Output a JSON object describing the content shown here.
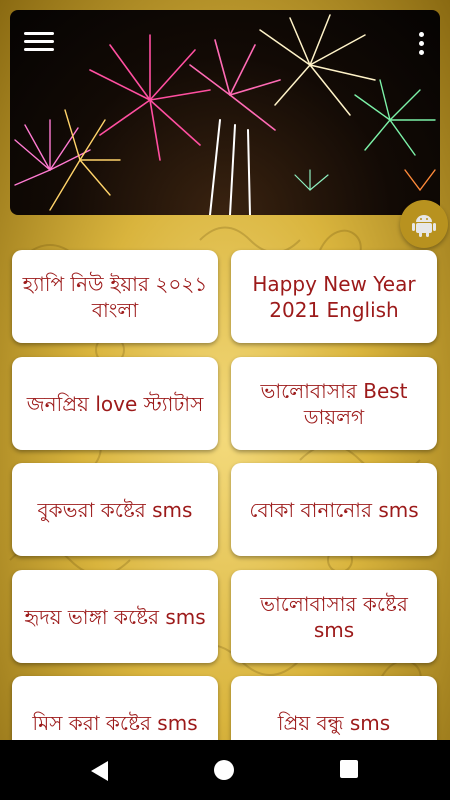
{
  "header": {
    "menu_icon": "hamburger-menu-icon",
    "more_icon": "more-vertical-icon",
    "banner_image": "fireworks-banner"
  },
  "fab": {
    "icon": "android-icon",
    "color": "#b8921f"
  },
  "menu": {
    "items": [
      {
        "label": "হ্যাপি নিউ ইয়ার ২০২১ বাংলা"
      },
      {
        "label": "Happy New Year 2021 English"
      },
      {
        "label": "জনপ্রিয় love স্ট্যাটাস"
      },
      {
        "label": "ভালোবাসার Best ডায়লগ"
      },
      {
        "label": "বুকভরা কষ্টের sms"
      },
      {
        "label": "বোকা বানানোর sms"
      },
      {
        "label": "হৃদয় ভাঙ্গা কষ্টের sms"
      },
      {
        "label": "ভালোবাসার কষ্টের sms"
      },
      {
        "label": "মিস করা কষ্টের sms"
      },
      {
        "label": "প্রিয় বন্ধু sms"
      }
    ]
  },
  "colors": {
    "card_text": "#9c1a1a",
    "background": "#d9b43d"
  },
  "navigation": {
    "back_icon": "back-triangle-icon",
    "home_icon": "home-circle-icon",
    "recent_icon": "recent-apps-square-icon"
  }
}
